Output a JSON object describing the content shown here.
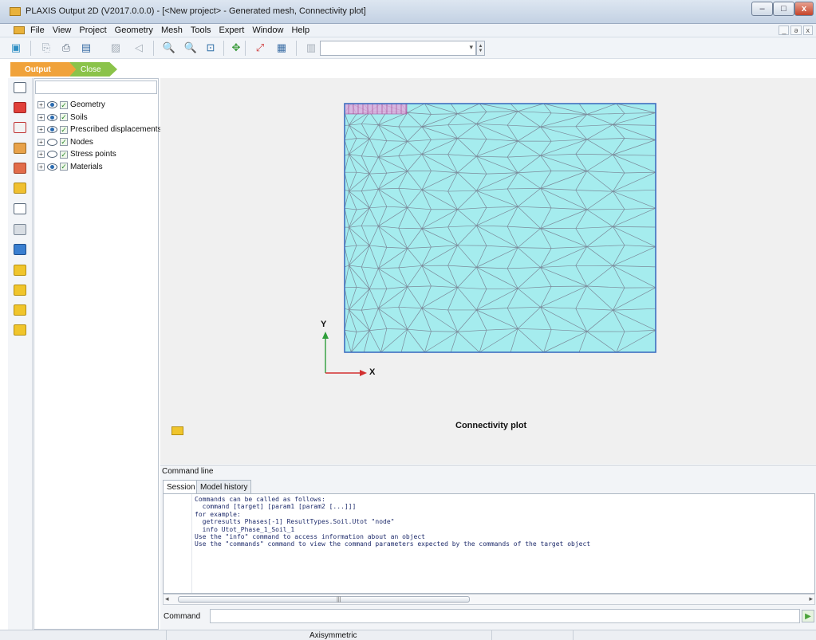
{
  "window": {
    "title": "PLAXIS Output 2D (V2017.0.0.0) - [<New project> - Generated mesh, Connectivity plot]",
    "controls": {
      "minimize": "–",
      "maximize": "□",
      "close": "x"
    }
  },
  "menu": {
    "items": [
      "File",
      "View",
      "Project",
      "Geometry",
      "Mesh",
      "Tools",
      "Expert",
      "Window",
      "Help"
    ],
    "mdi_controls": [
      "_",
      "ə",
      "x"
    ]
  },
  "toolbar": {
    "buttons": [
      {
        "name": "open-project-icon",
        "glyph": "▣",
        "color": "#2f8fc4"
      },
      {
        "name": "copy-icon",
        "glyph": "⎘",
        "color": "#9aa6b4"
      },
      {
        "name": "print-icon",
        "glyph": "⎙",
        "color": "#5b6a7c"
      },
      {
        "name": "report-icon",
        "glyph": "▤",
        "color": "#3b6ea5"
      },
      {
        "name": "image-icon",
        "glyph": "▨",
        "color": "#a5aeb8"
      },
      {
        "name": "animate-icon",
        "glyph": "◁",
        "color": "#a5aeb8"
      },
      {
        "name": "zoom-in-icon",
        "glyph": "🔍",
        "color": "#2e6ea6"
      },
      {
        "name": "zoom-out-icon",
        "glyph": "🔍",
        "color": "#a5aeb8"
      },
      {
        "name": "zoom-window-icon",
        "glyph": "⊡",
        "color": "#2e6ea6"
      },
      {
        "name": "pan-icon",
        "glyph": "✥",
        "color": "#3a9a3a"
      },
      {
        "name": "scale-icon",
        "glyph": "⤢",
        "color": "#d04040"
      },
      {
        "name": "table-icon",
        "glyph": "▦",
        "color": "#3b6ea5"
      },
      {
        "name": "grid-icon",
        "glyph": "▥",
        "color": "#a5aeb8"
      }
    ],
    "combo_value": "",
    "spin_up": "▲",
    "spin_down": "▼"
  },
  "nav": {
    "output": "Output",
    "close": "Close"
  },
  "tools": [
    {
      "name": "select-icon",
      "color": "#ffffff",
      "border": "#5b6a7c"
    },
    {
      "name": "cross-section-icon",
      "color": "#e0403a",
      "border": "#a02020"
    },
    {
      "name": "select-points-icon",
      "color": "#f2f2f2",
      "border": "#c03030"
    },
    {
      "name": "hint-box-icon",
      "color": "#e8a24a",
      "border": "#9c6a26"
    },
    {
      "name": "label-icon",
      "color": "#e26c4a",
      "border": "#a2442a"
    },
    {
      "name": "draw-scanline-icon",
      "color": "#f0c030",
      "border": "#b08a18"
    },
    {
      "name": "annotation-icon",
      "color": "#ffffff",
      "border": "#5b6a7c"
    },
    {
      "name": "ruler-icon",
      "color": "#d8dde3",
      "border": "#7a8796"
    },
    {
      "name": "info-icon",
      "color": "#3a7fd0",
      "border": "#1e4f8c"
    },
    {
      "name": "curve-point-icon",
      "color": "#f0c52c",
      "border": "#b48f12"
    },
    {
      "name": "curve-next-icon",
      "color": "#f0c52c",
      "border": "#b48f12"
    },
    {
      "name": "curve-export-icon",
      "color": "#f0c52c",
      "border": "#b48f12"
    },
    {
      "name": "edit-curve-icon",
      "color": "#f0c52c",
      "border": "#b48f12"
    }
  ],
  "explorer": {
    "search_placeholder": "",
    "items": [
      {
        "label": "Geometry",
        "eye": true
      },
      {
        "label": "Soils",
        "eye": true
      },
      {
        "label": "Prescribed displacements",
        "eye": true
      },
      {
        "label": "Nodes",
        "eye": false
      },
      {
        "label": "Stress points",
        "eye": false
      },
      {
        "label": "Materials",
        "eye": true
      }
    ]
  },
  "plot": {
    "caption": "Connectivity plot",
    "axis_y": "Y",
    "axis_x": "X",
    "mesh_fill": "#a5ecee",
    "mesh_line": "#7b8a9a",
    "border": "#3f6fc0",
    "load_fill": "#e7a6dd"
  },
  "command": {
    "panel_title": "Command line",
    "tabs": [
      "Session",
      "Model history"
    ],
    "console_lines": [
      "Commands can be called as follows:",
      "  command [target] [param1 [param2 [...]]]",
      "for example:",
      "  getresults Phases[-1] ResultTypes.Soil.Utot \"node\"",
      "  info Utot_Phase_1_Soil_1",
      "Use the \"info\" command to access information about an object",
      "Use the \"commands\" command to view the command parameters expected by the commands of the target object"
    ],
    "input_label": "Command",
    "input_value": "",
    "run_glyph": "▶",
    "scroll_left": "◂",
    "scroll_right": "▸",
    "scroll_grip": "|||"
  },
  "status": {
    "text": "Axisymmetric"
  }
}
